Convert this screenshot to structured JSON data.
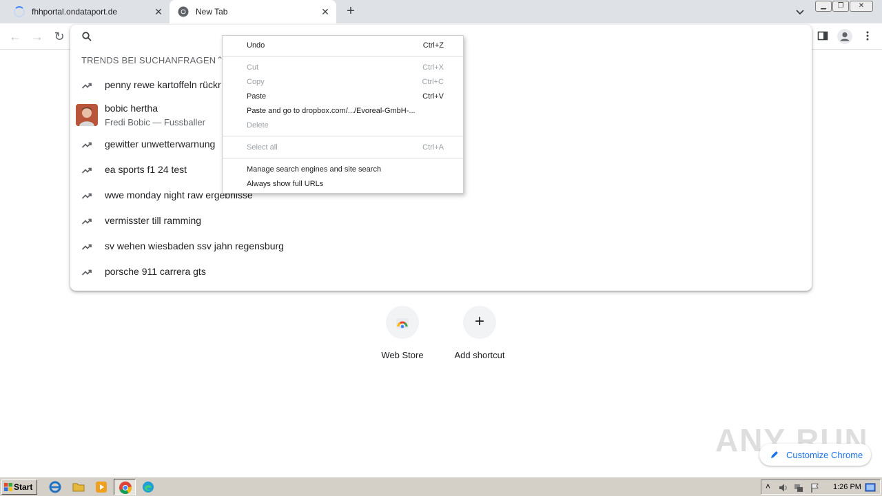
{
  "tabs": [
    {
      "title": "fhhportal.ondataport.de",
      "loading": true
    },
    {
      "title": "New Tab",
      "active": true
    }
  ],
  "omnibox": {
    "section_header": "TRENDS BEI SUCHANFRAGEN",
    "suggestions": [
      {
        "text": "penny rewe kartoffeln rückr",
        "icon": "trending-icon"
      },
      {
        "text": "bobic hertha",
        "subtext": "Fredi Bobic — Fussballer",
        "icon": "thumbnail"
      },
      {
        "text": "gewitter unwetterwarnung",
        "icon": "trending-icon"
      },
      {
        "text": "ea sports f1 24 test",
        "icon": "trending-icon"
      },
      {
        "text": "wwe monday night raw ergebnisse",
        "icon": "trending-icon"
      },
      {
        "text": "vermisster till ramming",
        "icon": "trending-icon"
      },
      {
        "text": "sv wehen wiesbaden ssv jahn regensburg",
        "icon": "trending-icon"
      },
      {
        "text": "porsche 911 carrera gts",
        "icon": "trending-icon"
      }
    ]
  },
  "context_menu": {
    "items": [
      {
        "label": "Undo",
        "shortcut": "Ctrl+Z",
        "enabled": true
      },
      {
        "label": "Cut",
        "shortcut": "Ctrl+X",
        "enabled": false
      },
      {
        "label": "Copy",
        "shortcut": "Ctrl+C",
        "enabled": false
      },
      {
        "label": "Paste",
        "shortcut": "Ctrl+V",
        "enabled": true
      },
      {
        "label": "Paste and go to dropbox.com/.../Evoreal-GmbH-...",
        "shortcut": "",
        "enabled": true
      },
      {
        "label": "Delete",
        "shortcut": "",
        "enabled": false
      },
      {
        "label": "Select all",
        "shortcut": "Ctrl+A",
        "enabled": false
      },
      {
        "label": "Manage search engines and site search",
        "shortcut": "",
        "enabled": true
      },
      {
        "label": "Always show full URLs",
        "shortcut": "",
        "enabled": true
      }
    ]
  },
  "ntp": {
    "shortcuts": [
      {
        "label": "Web Store",
        "icon": "web-store-icon"
      },
      {
        "label": "Add shortcut",
        "icon": "plus-icon"
      }
    ],
    "customize_label": "Customize Chrome"
  },
  "watermark": "ANY RUN",
  "taskbar": {
    "start_label": "Start",
    "clock": "1:26 PM"
  },
  "colors": {
    "tabstrip": "#dee1e6",
    "accent": "#1a73e8",
    "taskbar": "#d4d0c8"
  }
}
